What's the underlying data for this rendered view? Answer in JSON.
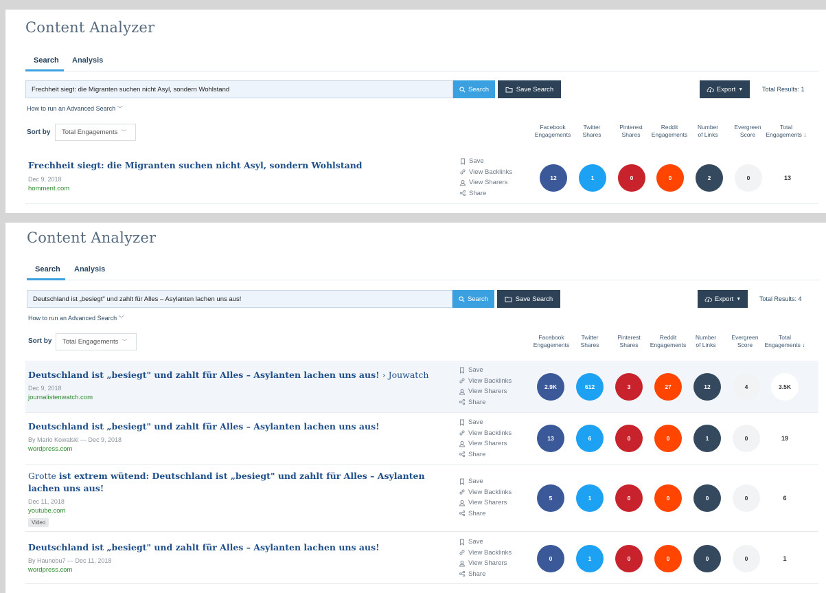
{
  "panels": [
    {
      "title": "Content Analyzer",
      "tabs": [
        "Search",
        "Analysis"
      ],
      "search_value": "Frechheit siegt: die Migranten suchen nicht Asyl, sondern Wohlstand",
      "search_label": "Search",
      "save_search_label": "Save Search",
      "export_label": "Export",
      "total_results": "Total Results: 1",
      "advanced_link": "How to run an Advanced Search",
      "sort_label": "Sort by",
      "sort_value": "Total Engagements",
      "columns": [
        [
          "Facebook",
          "Engagements"
        ],
        [
          "Twitter",
          "Shares"
        ],
        [
          "Pinterest",
          "Shares"
        ],
        [
          "Reddit",
          "Engagements"
        ],
        [
          "Number",
          "of Links"
        ],
        [
          "Evergreen",
          "Score"
        ],
        [
          "Total",
          "Engagements ↓"
        ]
      ],
      "actions": [
        "Save",
        "View Backlinks",
        "View Sharers",
        "Share"
      ],
      "rows": [
        {
          "title_bold": "Frechheit siegt: die Migranten suchen nicht Asyl, sondern Wohlstand",
          "meta": "Dec 9, 2018",
          "domain": "homment.com",
          "facebook": "12",
          "twitter": "1",
          "pinterest": "0",
          "reddit": "0",
          "links": "2",
          "evergreen": "0",
          "total": "13"
        }
      ]
    },
    {
      "title": "Content Analyzer",
      "tabs": [
        "Search",
        "Analysis"
      ],
      "search_value": "Deutschland ist „besiegt\" und zahlt für Alles – Asylanten lachen uns aus!",
      "search_label": "Search",
      "save_search_label": "Save Search",
      "export_label": "Export",
      "total_results": "Total Results: 4",
      "advanced_link": "How to run an Advanced Search",
      "sort_label": "Sort by",
      "sort_value": "Total Engagements",
      "columns": [
        [
          "Facebook",
          "Engagements"
        ],
        [
          "Twitter",
          "Shares"
        ],
        [
          "Pinterest",
          "Shares"
        ],
        [
          "Reddit",
          "Engagements"
        ],
        [
          "Number",
          "of Links"
        ],
        [
          "Evergreen",
          "Score"
        ],
        [
          "Total",
          "Engagements ↓"
        ]
      ],
      "actions": [
        "Save",
        "View Backlinks",
        "View Sharers",
        "Share"
      ],
      "rows": [
        {
          "title_bold": "Deutschland ist „besiegt\" und zahlt für Alles – Asylanten lachen uns aus!",
          "title_suffix": " › Jouwatch",
          "meta": "Dec 9, 2018",
          "domain": "journalistenwatch.com",
          "facebook": "2.9K",
          "twitter": "612",
          "pinterest": "3",
          "reddit": "27",
          "links": "12",
          "evergreen": "4",
          "total": "3.5K"
        },
        {
          "title_bold": "Deutschland ist „besiegt\" und zahlt für Alles – Asylanten lachen uns aus!",
          "meta": "By Mario Kowalski — Dec 9, 2018",
          "domain": "wordpress.com",
          "facebook": "13",
          "twitter": "6",
          "pinterest": "0",
          "reddit": "0",
          "links": "1",
          "evergreen": "0",
          "total": "19"
        },
        {
          "title_prefix": "Grotte ",
          "title_mid": "ist extrem wütend: Deutschland ist „besiegt\" und zahlt für Alles – Asylanten lachen uns aus!",
          "meta": "Dec 11, 2018",
          "domain": "youtube.com",
          "badge": "Video",
          "facebook": "5",
          "twitter": "1",
          "pinterest": "0",
          "reddit": "0",
          "links": "0",
          "evergreen": "0",
          "total": "6"
        },
        {
          "title_bold": "Deutschland ist „besiegt\" und zahlt für Alles – Asylanten lachen uns aus!",
          "meta": "By Haunebu7 — Dec 11, 2018",
          "domain": "wordpress.com",
          "facebook": "0",
          "twitter": "1",
          "pinterest": "0",
          "reddit": "0",
          "links": "0",
          "evergreen": "0",
          "total": "1"
        }
      ]
    }
  ],
  "colors": {
    "facebook": "#3b5998",
    "twitter": "#1da1f2",
    "pinterest": "#c8232c",
    "reddit": "#ff4500",
    "links": "#35495e",
    "accent": "#3aa0e0",
    "dark_button": "#2e4257"
  }
}
